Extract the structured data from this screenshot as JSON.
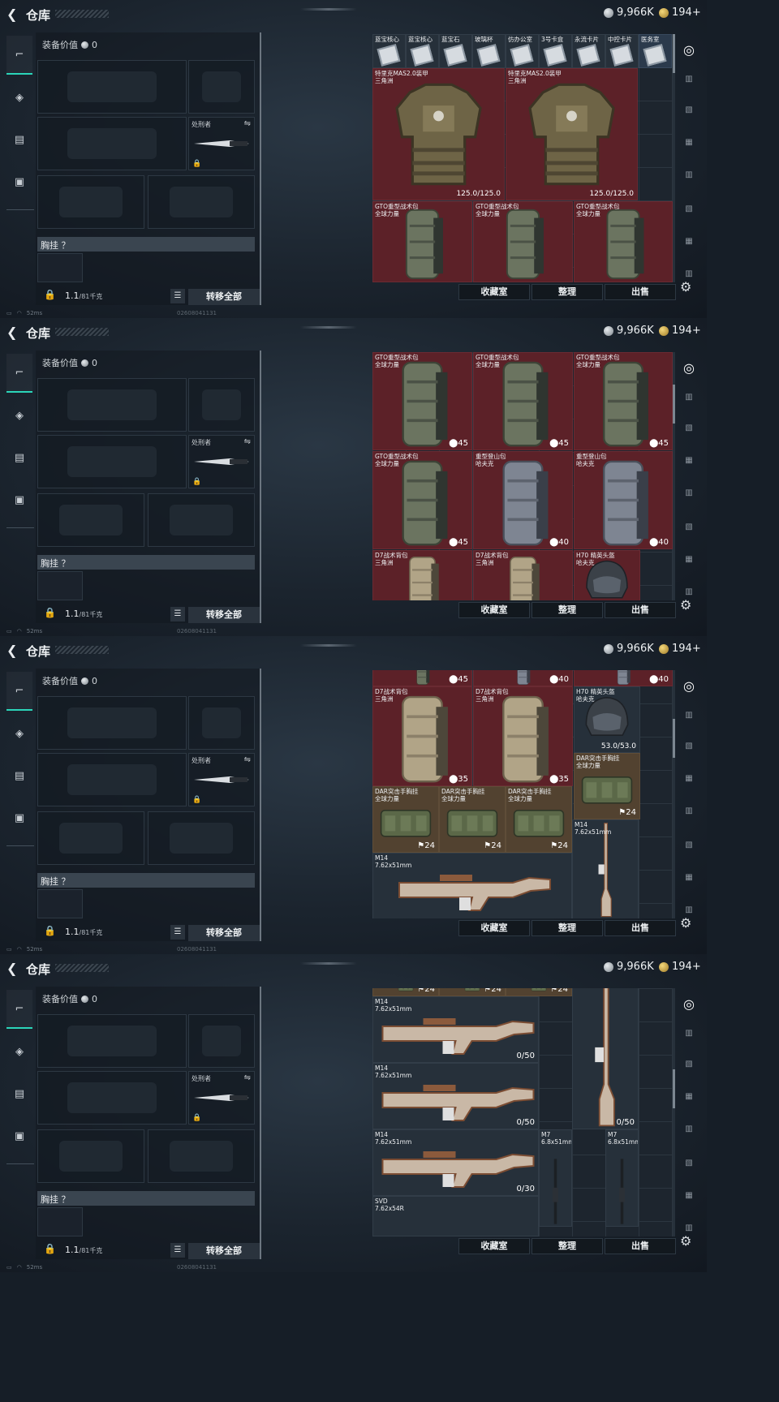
{
  "header": {
    "back_icon": "back-arrow-icon",
    "title": "仓库",
    "silver": "9,966K",
    "gold": "194+"
  },
  "tabs": [
    {
      "icon": "pistol-icon",
      "glyph": "⌐",
      "active": true
    },
    {
      "icon": "helmet-icon",
      "glyph": "◈",
      "active": false
    },
    {
      "icon": "vest-icon",
      "glyph": "▤",
      "active": false
    },
    {
      "icon": "briefcase-icon",
      "glyph": "▣",
      "active": false
    }
  ],
  "loadout": {
    "equip_value_label": "装备价值",
    "equip_value": "0",
    "melee_name": "处刑者",
    "chest_label": "胸挂 ？",
    "weight": "1.1",
    "weight_cap": "/81千克",
    "move_all": "转移全部"
  },
  "status": {
    "signal": "52ms",
    "serial": "02608041131"
  },
  "bottom": {
    "favorites": "收藏室",
    "sort": "整理",
    "sell": "出售"
  },
  "sidebar": [
    "◎",
    "▥",
    "▧",
    "▦",
    "▥",
    "▧",
    "▦",
    "▥"
  ],
  "frames": [
    {
      "cards": [
        {
          "name": "蓝宝核心"
        },
        {
          "name": "蓝宝核心"
        },
        {
          "name": "蓝宝石"
        },
        {
          "name": "玻璃杯"
        },
        {
          "name": "仿办公室"
        },
        {
          "name": "3号卡盒"
        },
        {
          "name": "永流卡片"
        },
        {
          "name": "中控卡片"
        },
        {
          "name": "医务室"
        }
      ],
      "items": [
        {
          "name": "特里克MAS2.0装甲\n三角洲",
          "value": "125.0/125.0",
          "color": "red",
          "art": "armor"
        },
        {
          "name": "特里克MAS2.0装甲\n三角洲",
          "value": "125.0/125.0",
          "color": "red",
          "art": "armor"
        },
        {
          "name": "GTO重型战术包\n全球力量",
          "value": "",
          "color": "red",
          "art": "pack"
        },
        {
          "name": "GTO重型战术包\n全球力量",
          "value": "",
          "color": "red",
          "art": "pack"
        },
        {
          "name": "GTO重型战术包\n全球力量",
          "value": "",
          "color": "red",
          "art": "pack"
        }
      ]
    },
    {
      "items": [
        {
          "name": "GTO重型战术包\n全球力量",
          "value": "⬤45",
          "color": "red",
          "art": "pack"
        },
        {
          "name": "GTO重型战术包\n全球力量",
          "value": "⬤45",
          "color": "red",
          "art": "pack"
        },
        {
          "name": "GTO重型战术包\n全球力量",
          "value": "⬤45",
          "color": "red",
          "art": "pack"
        },
        {
          "name": "GTO重型战术包\n全球力量",
          "value": "⬤45",
          "color": "red",
          "art": "pack"
        },
        {
          "name": "重型登山包\n哈夫克",
          "value": "⬤40",
          "color": "red",
          "art": "packgrey"
        },
        {
          "name": "重型登山包\n哈夫克",
          "value": "⬤40",
          "color": "red",
          "art": "packgrey"
        },
        {
          "name": "D7战术背包\n三角洲",
          "value": "",
          "color": "red",
          "art": "packtan"
        },
        {
          "name": "D7战术背包\n三角洲",
          "value": "",
          "color": "red",
          "art": "packtan"
        },
        {
          "name": "H70 精英头盔\n哈夫克",
          "value": "",
          "color": "red",
          "art": "helmet"
        }
      ]
    },
    {
      "items": [
        {
          "name": "",
          "value": "⬤45",
          "color": "red",
          "art": "pack"
        },
        {
          "name": "",
          "value": "⬤40",
          "color": "red",
          "art": "packgrey"
        },
        {
          "name": "",
          "value": "⬤40",
          "color": "red",
          "art": "packgrey"
        },
        {
          "name": "D7战术背包\n三角洲",
          "value": "⬤35",
          "color": "red",
          "art": "packtan"
        },
        {
          "name": "D7战术背包\n三角洲",
          "value": "⬤35",
          "color": "red",
          "art": "packtan"
        },
        {
          "name": "H70 精英头盔\n哈夫克",
          "value": "53.0/53.0",
          "color": "dark",
          "art": "helmet"
        },
        {
          "name": "DAR突击手胸挂\n全球力量",
          "value": "⚑24",
          "color": "tan",
          "art": "rig"
        },
        {
          "name": "DAR突击手胸挂\n全球力量",
          "value": "⚑24",
          "color": "tan",
          "art": "rig"
        },
        {
          "name": "DAR突击手胸挂\n全球力量",
          "value": "⚑24",
          "color": "tan",
          "art": "rig"
        },
        {
          "name": "DAR突击手胸挂\n全球力量",
          "value": "⚑24",
          "color": "tan",
          "art": "rig"
        },
        {
          "name": "M14\n7.62x51mm",
          "value": "",
          "color": "dark",
          "art": "rifle"
        },
        {
          "name": "M14\n7.62x51mm",
          "value": "",
          "color": "dark",
          "art": "riflev"
        }
      ]
    },
    {
      "items": [
        {
          "name": "",
          "value": "⚑24",
          "color": "tan",
          "art": "rig"
        },
        {
          "name": "",
          "value": "⚑24",
          "color": "tan",
          "art": "rig"
        },
        {
          "name": "",
          "value": "⚑24",
          "color": "tan",
          "art": "rig"
        },
        {
          "name": "M14\n7.62x51mm",
          "value": "0/50",
          "color": "dark",
          "art": "rifle"
        },
        {
          "name": "M14\n7.62x51mm",
          "value": "0/50",
          "color": "dark",
          "art": "rifle"
        },
        {
          "name": "M14\n7.62x51mm",
          "value": "0/30",
          "color": "dark",
          "art": "rifle"
        },
        {
          "name": "7.62x51mm",
          "value": "0/50",
          "color": "dark",
          "art": "riflev"
        },
        {
          "name": "M7\n6.8x51mm",
          "value": "",
          "color": "dark",
          "art": "riflevd"
        },
        {
          "name": "M7\n6.8x51mm",
          "value": "",
          "color": "dark",
          "art": "riflevd"
        },
        {
          "name": "SVD\n7.62x54R",
          "value": "",
          "color": "dark",
          "art": "none"
        }
      ]
    }
  ]
}
